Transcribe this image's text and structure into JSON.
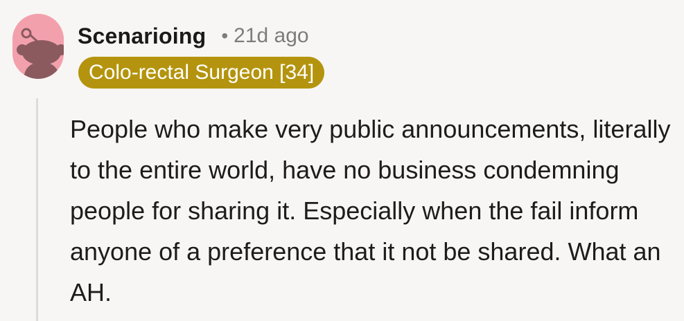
{
  "comment": {
    "author": "Scenarioing",
    "separator": "•",
    "age": "21d ago",
    "flair": "Colo-rectal Surgeon [34]",
    "body": "People who make very public announcements, literally to the entire world, have no business condemning people for sharing it. Especially when the fail inform anyone of a preference that it not be shared. What an AH."
  },
  "colors": {
    "avatar_bg": "#f3a0ad",
    "avatar_figure": "#8a5a5f",
    "flair_bg": "#b4940e",
    "flair_text": "#ffffff",
    "thread_line": "#dcdcdc"
  },
  "icons": {
    "avatar": "snoo-avatar-icon"
  }
}
